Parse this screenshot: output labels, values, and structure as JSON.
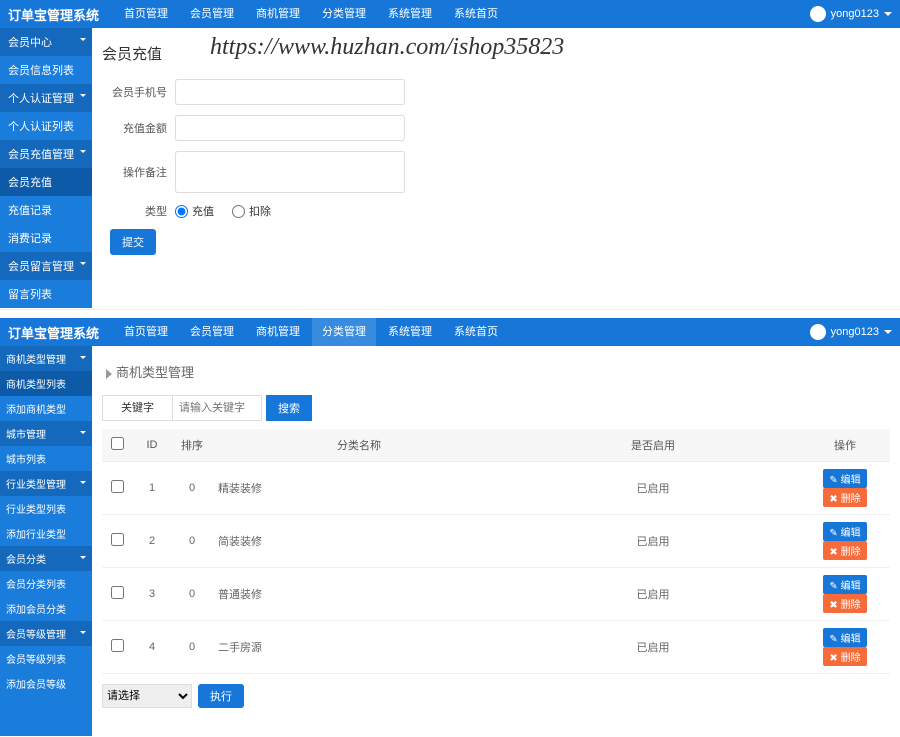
{
  "watermark": "https://www.huzhan.com/ishop35823",
  "panel1": {
    "logo": "订单宝管理系统",
    "nav": [
      "首页管理",
      "会员管理",
      "商机管理",
      "分类管理",
      "系统管理",
      "系统首页"
    ],
    "user": "yong0123",
    "sidebar": [
      {
        "label": "会员中心",
        "type": "header"
      },
      {
        "label": "会员信息列表"
      },
      {
        "label": "个人认证管理",
        "type": "header"
      },
      {
        "label": "个人认证列表"
      },
      {
        "label": "会员充值管理",
        "type": "header"
      },
      {
        "label": "会员充值",
        "active": true
      },
      {
        "label": "充值记录"
      },
      {
        "label": "消费记录"
      },
      {
        "label": "会员留言管理",
        "type": "header"
      },
      {
        "label": "留言列表"
      }
    ],
    "form": {
      "title": "会员充值",
      "fields": {
        "phone_label": "会员手机号",
        "amount_label": "充值金额",
        "remark_label": "操作备注",
        "type_label": "类型",
        "radio1": "充值",
        "radio2": "扣除"
      },
      "submit": "提交"
    }
  },
  "panel2": {
    "logo": "订单宝管理系统",
    "nav": [
      "首页管理",
      "会员管理",
      "商机管理",
      "分类管理",
      "系统管理",
      "系统首页"
    ],
    "nav_active_index": 3,
    "user": "yong0123",
    "sidebar": [
      {
        "label": "商机类型管理",
        "type": "header"
      },
      {
        "label": "商机类型列表",
        "active": true
      },
      {
        "label": "添加商机类型"
      },
      {
        "label": "城市管理",
        "type": "header"
      },
      {
        "label": "城市列表"
      },
      {
        "label": "行业类型管理",
        "type": "header"
      },
      {
        "label": "行业类型列表"
      },
      {
        "label": "添加行业类型"
      },
      {
        "label": "会员分类",
        "type": "header"
      },
      {
        "label": "会员分类列表"
      },
      {
        "label": "添加会员分类"
      },
      {
        "label": "会员等级管理",
        "type": "header"
      },
      {
        "label": "会员等级列表"
      },
      {
        "label": "添加会员等级"
      }
    ],
    "crumb": "商机类型管理",
    "search": {
      "label": "关键字",
      "placeholder": "请输入关键字",
      "button": "搜索"
    },
    "table": {
      "headers": [
        "",
        "ID",
        "排序",
        "分类名称",
        "是否启用",
        "操作"
      ],
      "rows": [
        {
          "id": "1",
          "sort": "0",
          "name": "精装装修",
          "enabled": "已启用"
        },
        {
          "id": "2",
          "sort": "0",
          "name": "简装装修",
          "enabled": "已启用"
        },
        {
          "id": "3",
          "sort": "0",
          "name": "普通装修",
          "enabled": "已启用"
        },
        {
          "id": "4",
          "sort": "0",
          "name": "二手房源",
          "enabled": "已启用"
        }
      ],
      "edit_btn": "编辑",
      "del_btn": "删除"
    },
    "bulk": {
      "placeholder": "请选择",
      "button": "执行"
    }
  }
}
